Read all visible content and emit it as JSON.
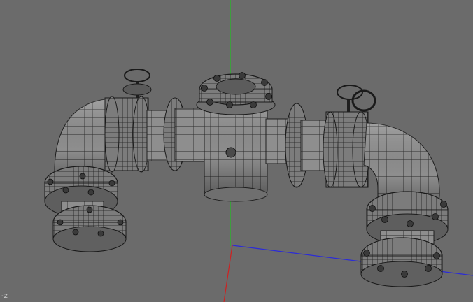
{
  "viewport": {
    "background": "#6b6b6b",
    "mesh_fill": "#8c8c8c",
    "wire_color": "#1e1e1e",
    "corner_label": "-z",
    "axes": {
      "x_color": "#2b2bd8",
      "y_color": "#20c020",
      "z_color": "#d02020"
    }
  }
}
